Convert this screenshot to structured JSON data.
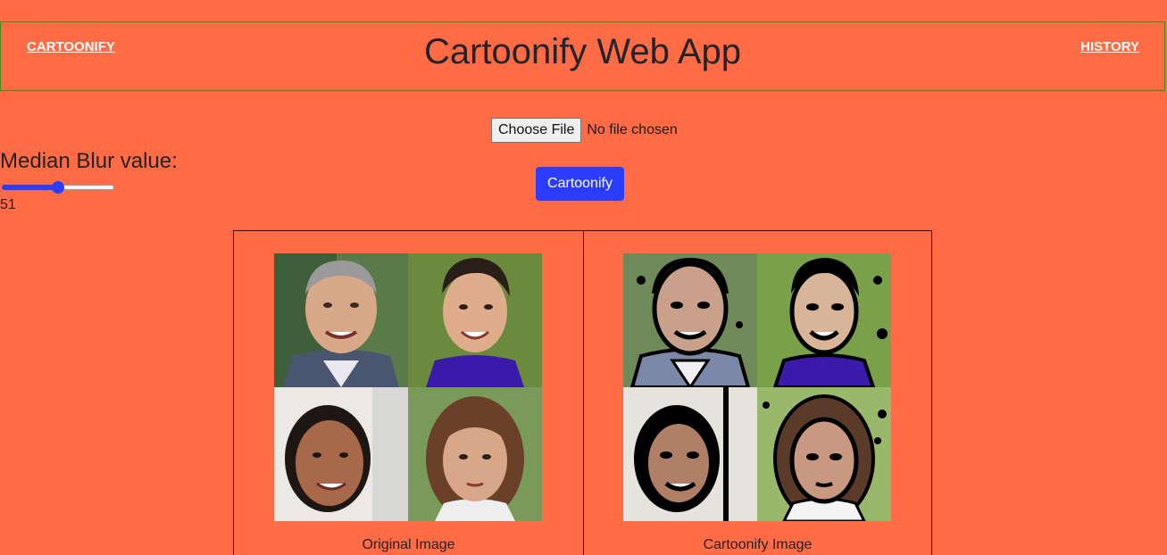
{
  "header": {
    "left_link": "CARTOONIFY",
    "title": "Cartoonify Web App",
    "right_link": "HISTORY"
  },
  "upload": {
    "button_label": "Choose File",
    "status": "No file chosen"
  },
  "action": {
    "cartoonify_label": "Cartoonify"
  },
  "blur": {
    "label": "Median Blur value:",
    "value": "51",
    "fraction": 0.5
  },
  "results": {
    "original_caption": "Original Image",
    "cartoon_caption": "Cartoonify Image"
  },
  "colors": {
    "background": "#ff6b45",
    "accent": "#2a3dff",
    "header_border": "#3d8c1f"
  }
}
